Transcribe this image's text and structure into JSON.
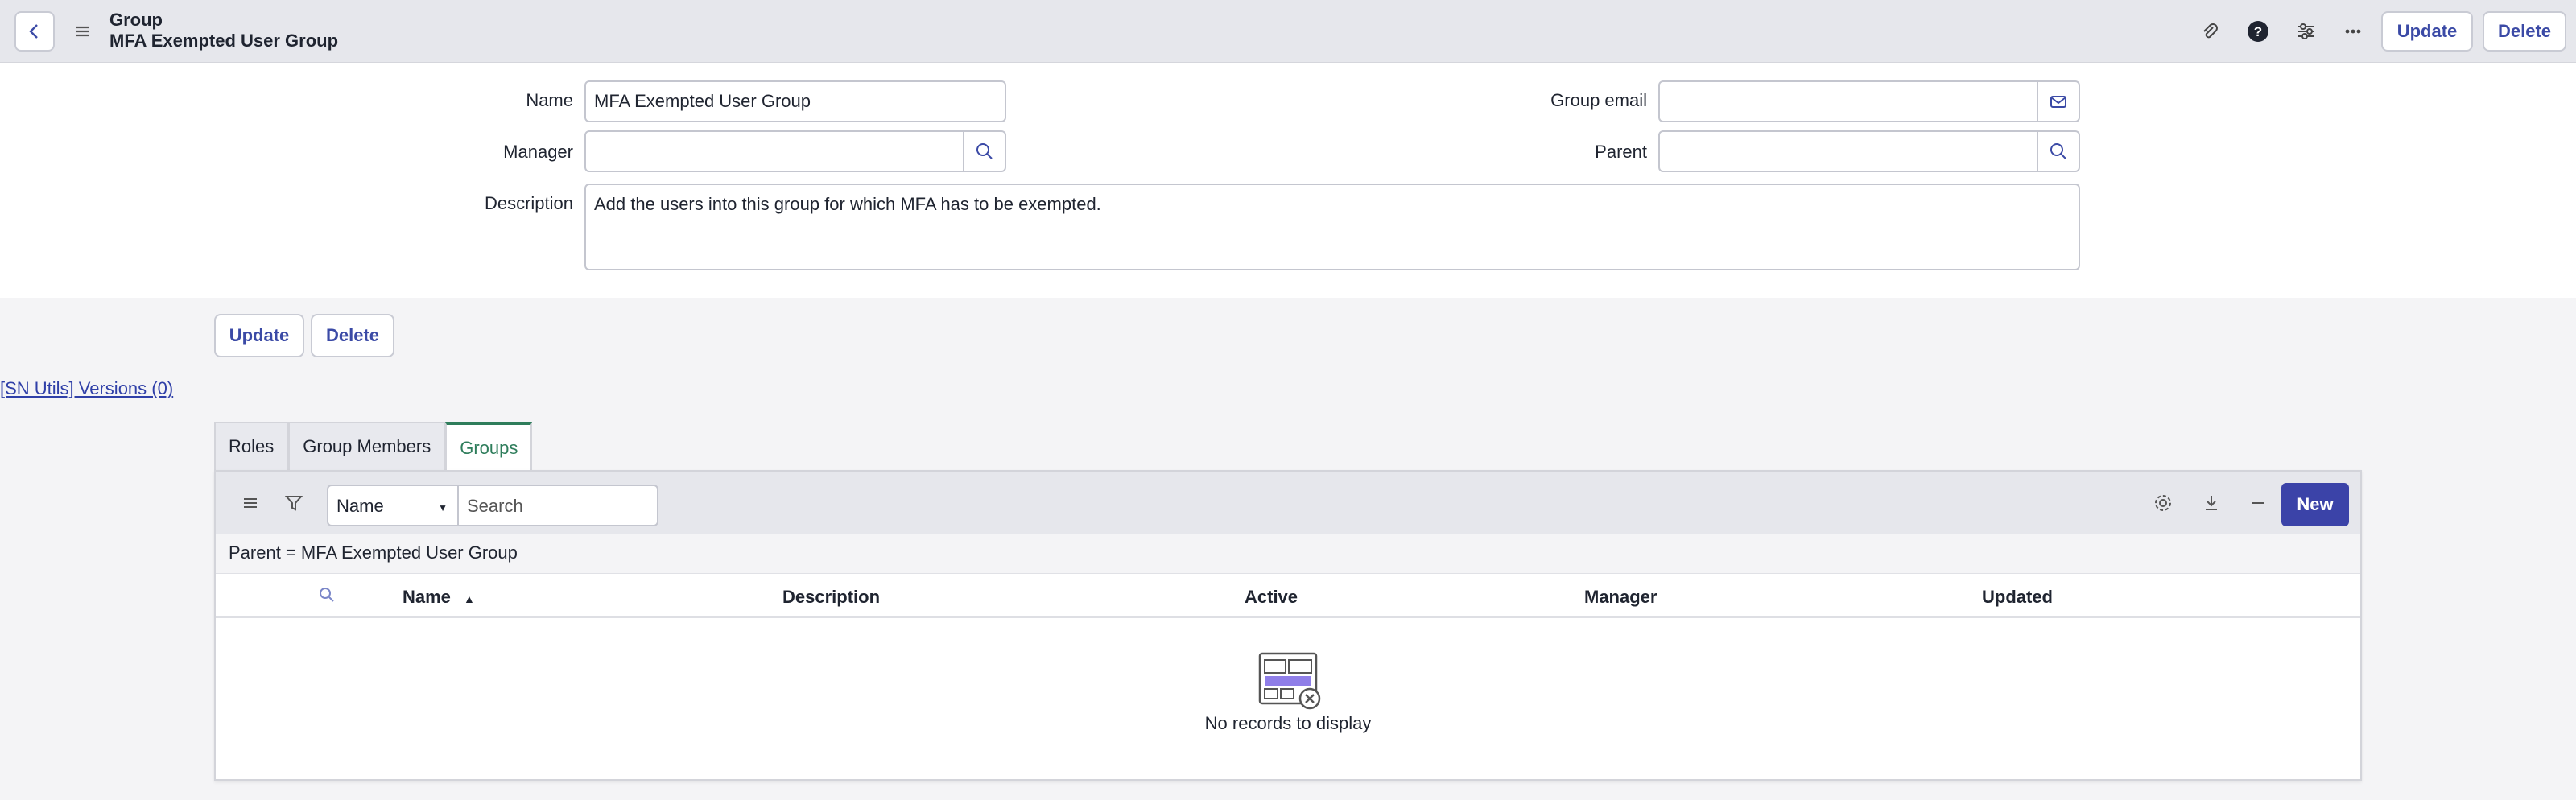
{
  "header": {
    "record_type": "Group",
    "record_name": "MFA Exempted User Group",
    "update_label": "Update",
    "delete_label": "Delete",
    "icons": [
      "chevron-left-icon",
      "hamburger-icon",
      "paperclip-icon",
      "help-icon",
      "settings-sliders-icon",
      "more-icon"
    ]
  },
  "form": {
    "name_label": "Name",
    "name_value": "MFA Exempted User Group",
    "manager_label": "Manager",
    "manager_value": "",
    "description_label": "Description",
    "description_value": "Add the users into this group for which MFA has to be exempted.",
    "group_email_label": "Group email",
    "group_email_value": "",
    "parent_label": "Parent",
    "parent_value": ""
  },
  "actions": {
    "update_label": "Update",
    "delete_label": "Delete"
  },
  "sn_utils_link": "[SN Utils] Versions (0)",
  "tabs": [
    {
      "label": "Roles",
      "active": false
    },
    {
      "label": "Group Members",
      "active": false
    },
    {
      "label": "Groups",
      "active": true
    }
  ],
  "related_list": {
    "field_select": "Name",
    "search_placeholder": "Search",
    "new_label": "New",
    "filter_text": "Parent = MFA Exempted User Group",
    "columns": [
      "Name",
      "Description",
      "Active",
      "Manager",
      "Updated"
    ],
    "sort_column": "Name",
    "sort_direction": "ascending",
    "empty_message": "No records to display"
  },
  "colors": {
    "accent": "#3b43a8",
    "tab_active": "#2e7d5b",
    "link": "#2f3fa8"
  }
}
